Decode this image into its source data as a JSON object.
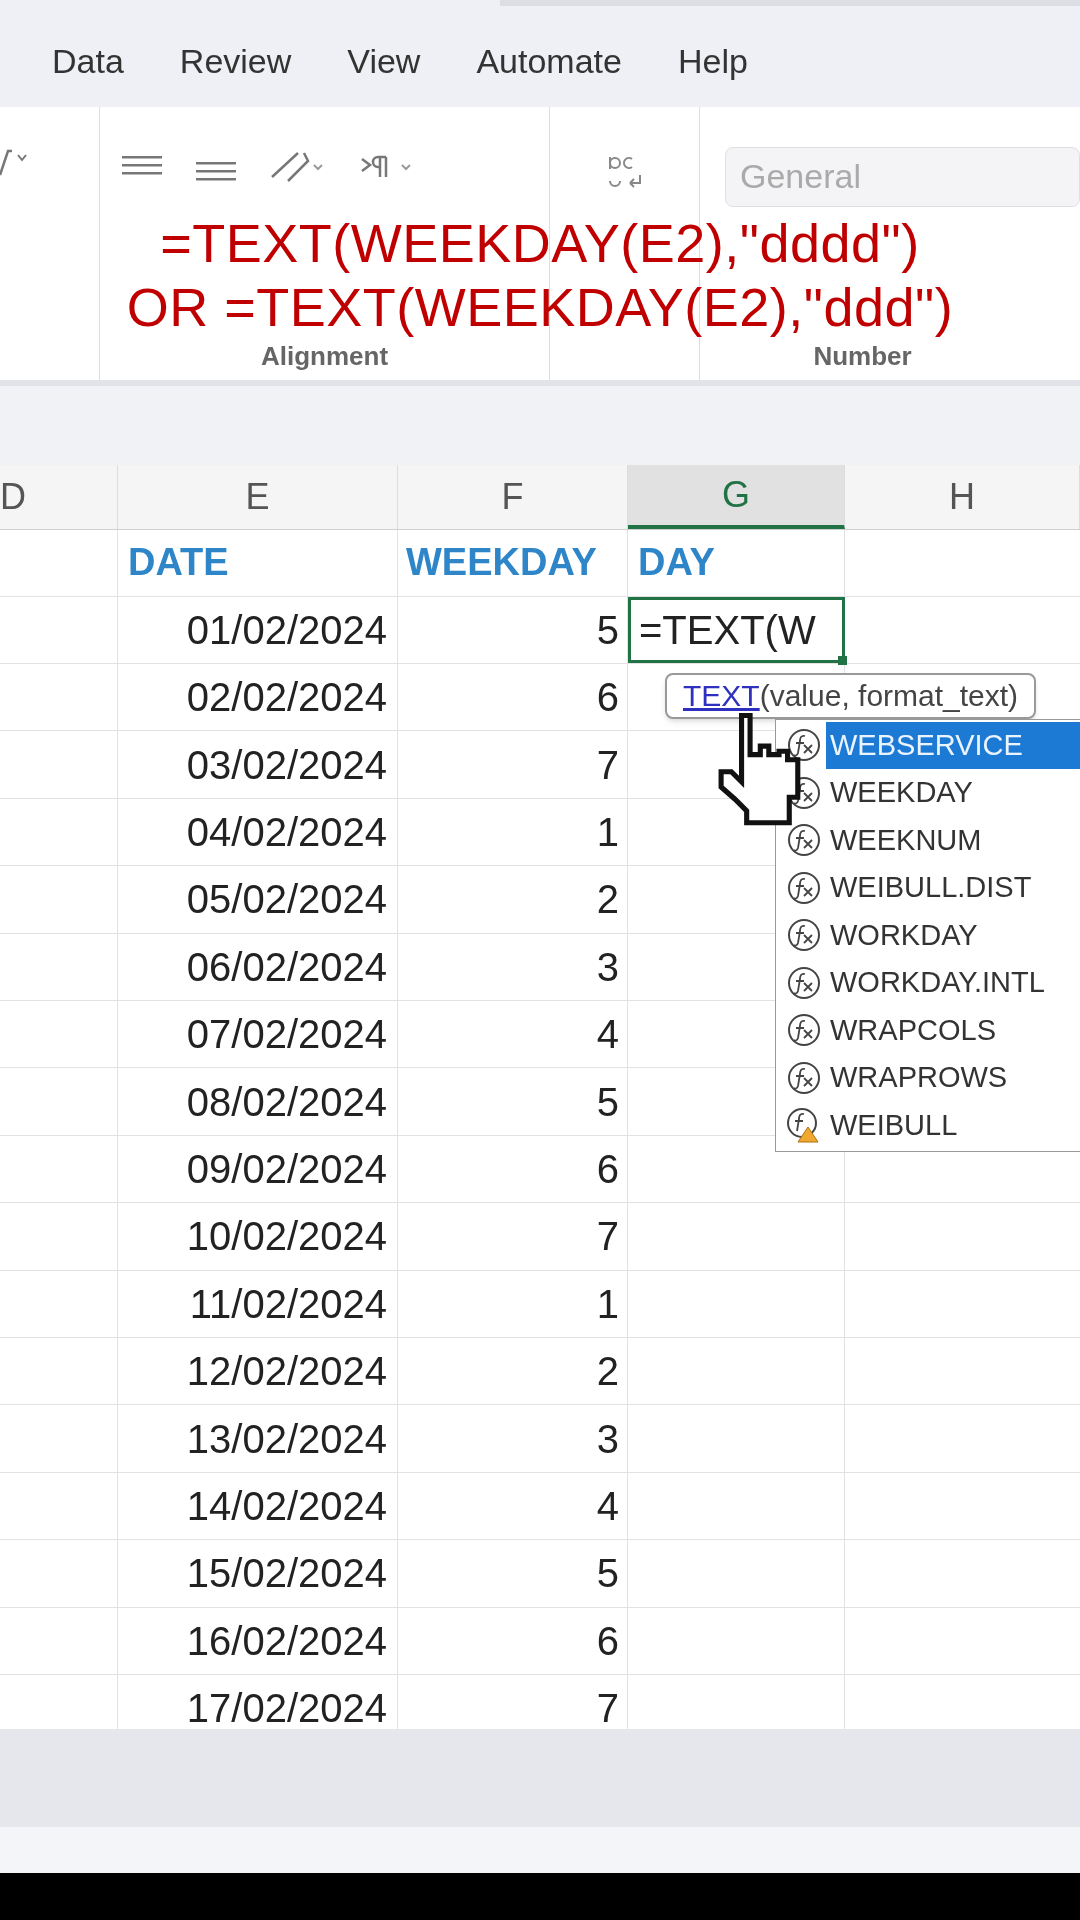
{
  "menu_tabs": [
    {
      "label": "Data"
    },
    {
      "label": "Review"
    },
    {
      "label": "View"
    },
    {
      "label": "Automate"
    },
    {
      "label": "Help"
    }
  ],
  "ribbon": {
    "number_format": "General",
    "groups": [
      "Alignment",
      "Number"
    ]
  },
  "caption": [
    "=TEXT(WEEKDAY(E2),\"dddd\")",
    "OR =TEXT(WEEKDAY(E2),\"ddd\")"
  ],
  "columns": [
    {
      "label": "D",
      "selected": false
    },
    {
      "label": "E",
      "selected": false
    },
    {
      "label": "F",
      "selected": false
    },
    {
      "label": "G",
      "selected": true
    },
    {
      "label": "H",
      "selected": false
    }
  ],
  "header_row": {
    "date": "DATE",
    "weekday": "WEEKDAY",
    "day": "DAY"
  },
  "rows": [
    {
      "date": "01/02/2024",
      "weekday": "5",
      "day": "=TEXT(W",
      "active": true
    },
    {
      "date": "02/02/2024",
      "weekday": "6",
      "active": false
    },
    {
      "date": "03/02/2024",
      "weekday": "7",
      "active": false
    },
    {
      "date": "04/02/2024",
      "weekday": "1",
      "active": false
    },
    {
      "date": "05/02/2024",
      "weekday": "2",
      "active": false
    },
    {
      "date": "06/02/2024",
      "weekday": "3",
      "active": false
    },
    {
      "date": "07/02/2024",
      "weekday": "4",
      "active": false
    },
    {
      "date": "08/02/2024",
      "weekday": "5",
      "active": false
    },
    {
      "date": "09/02/2024",
      "weekday": "6",
      "active": false
    },
    {
      "date": "10/02/2024",
      "weekday": "7",
      "active": false
    },
    {
      "date": "11/02/2024",
      "weekday": "1",
      "active": false
    },
    {
      "date": "12/02/2024",
      "weekday": "2",
      "active": false
    },
    {
      "date": "13/02/2024",
      "weekday": "3",
      "active": false
    },
    {
      "date": "14/02/2024",
      "weekday": "4",
      "active": false
    },
    {
      "date": "15/02/2024",
      "weekday": "5",
      "active": false
    },
    {
      "date": "16/02/2024",
      "weekday": "6",
      "active": false
    },
    {
      "date": "17/02/2024",
      "weekday": "7",
      "active": false
    }
  ],
  "tooltip": {
    "function": "TEXT",
    "arguments": "(value, format_text)"
  },
  "autocomplete": [
    {
      "label": "WEBSERVICE",
      "kind": "function",
      "selected": true
    },
    {
      "label": "WEEKDAY",
      "kind": "function",
      "selected": false
    },
    {
      "label": "WEEKNUM",
      "kind": "function",
      "selected": false
    },
    {
      "label": "WEIBULL.DIST",
      "kind": "function",
      "selected": false
    },
    {
      "label": "WORKDAY",
      "kind": "function",
      "selected": false
    },
    {
      "label": "WORKDAY.INTL",
      "kind": "function",
      "selected": false
    },
    {
      "label": "WRAPCOLS",
      "kind": "function",
      "selected": false
    },
    {
      "label": "WRAPROWS",
      "kind": "function",
      "selected": false
    },
    {
      "label": "WEIBULL",
      "kind": "warning",
      "selected": false
    }
  ]
}
